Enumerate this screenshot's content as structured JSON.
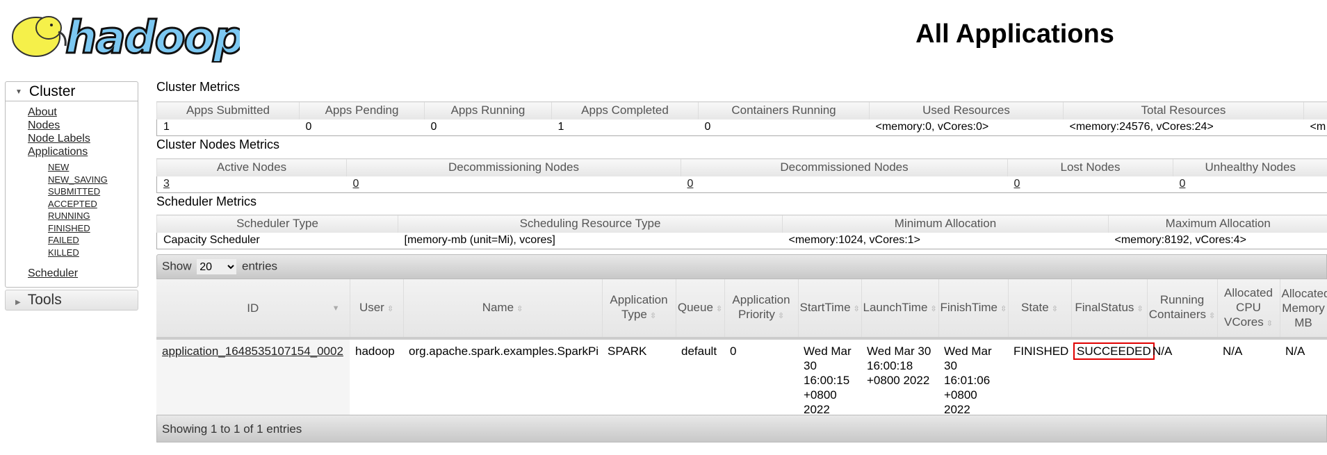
{
  "logo": {
    "text": "hadoop"
  },
  "header": {
    "title": "All Applications"
  },
  "sidebar": {
    "cluster_label": "Cluster",
    "links": [
      "About",
      "Nodes",
      "Node Labels",
      "Applications"
    ],
    "states": [
      "NEW",
      "NEW_SAVING",
      "SUBMITTED",
      "ACCEPTED",
      "RUNNING",
      "FINISHED",
      "FAILED",
      "KILLED"
    ],
    "scheduler": "Scheduler",
    "tools_label": "Tools"
  },
  "cluster_metrics": {
    "title": "Cluster Metrics",
    "headers": [
      "Apps Submitted",
      "Apps Pending",
      "Apps Running",
      "Apps Completed",
      "Containers Running",
      "Used Resources",
      "Total Resources",
      ""
    ],
    "values": [
      "1",
      "0",
      "0",
      "1",
      "0",
      "<memory:0, vCores:0>",
      "<memory:24576, vCores:24>",
      "<m"
    ]
  },
  "nodes_metrics": {
    "title": "Cluster Nodes Metrics",
    "headers": [
      "Active Nodes",
      "Decommissioning Nodes",
      "Decommissioned Nodes",
      "Lost Nodes",
      "Unhealthy Nodes"
    ],
    "values": [
      "3",
      "0",
      "0",
      "0",
      "0"
    ]
  },
  "scheduler_metrics": {
    "title": "Scheduler Metrics",
    "headers": [
      "Scheduler Type",
      "Scheduling Resource Type",
      "Minimum Allocation",
      "Maximum Allocation"
    ],
    "values": [
      "Capacity Scheduler",
      "[memory-mb (unit=Mi), vcores]",
      "<memory:1024, vCores:1>",
      "<memory:8192, vCores:4>"
    ]
  },
  "show": {
    "prefix": "Show",
    "value": "20",
    "suffix": "entries"
  },
  "apps": {
    "headers": [
      "ID",
      "User",
      "Name",
      "Application Type",
      "Queue",
      "Application Priority",
      "StartTime",
      "LaunchTime",
      "FinishTime",
      "State",
      "FinalStatus",
      "Running Containers",
      "Allocated CPU VCores",
      "Allocated Memory MB"
    ],
    "rows": [
      [
        "application_1648535107154_0002",
        "hadoop",
        "org.apache.spark.examples.SparkPi",
        "SPARK",
        "default",
        "0",
        "Wed Mar 30 16:00:15 +0800 2022",
        "Wed Mar 30 16:00:18 +0800 2022",
        "Wed Mar 30 16:01:06 +0800 2022",
        "FINISHED",
        "SUCCEEDED",
        "N/A",
        "N/A",
        "N/A"
      ]
    ],
    "highlight_color": "#e00000"
  },
  "footer": {
    "info": "Showing 1 to 1 of 1 entries"
  }
}
